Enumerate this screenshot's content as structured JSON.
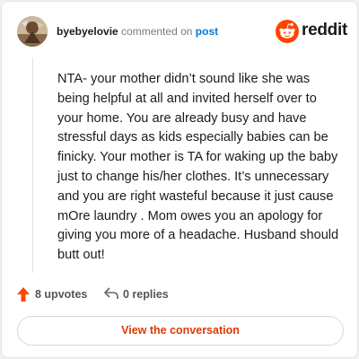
{
  "comment": {
    "username": "byebyelovie",
    "action_text": "commented on",
    "target_link": "post",
    "body": "NTA- your mother didn’t sound like she was being helpful at all and invited herself over to your home. You are already busy and have stressful days as kids especially babies can be finicky. Your mother is TA for waking up the baby just to change his/her clothes. It’s unnecessary and you are right wasteful because it just cause mOre laundry . Mom owes you an apology for giving you more of a headache. Husband should butt out!"
  },
  "brand": {
    "name": "reddit",
    "icon": "reddit-snoo-icon",
    "color": "#ff4500"
  },
  "actions": {
    "upvotes_label": "8 upvotes",
    "upvote_icon": "upvote-arrow-icon",
    "replies_label": "0 replies",
    "reply_icon": "reply-arrow-icon"
  },
  "cta": {
    "label": "View the conversation",
    "color": "#e03800"
  }
}
